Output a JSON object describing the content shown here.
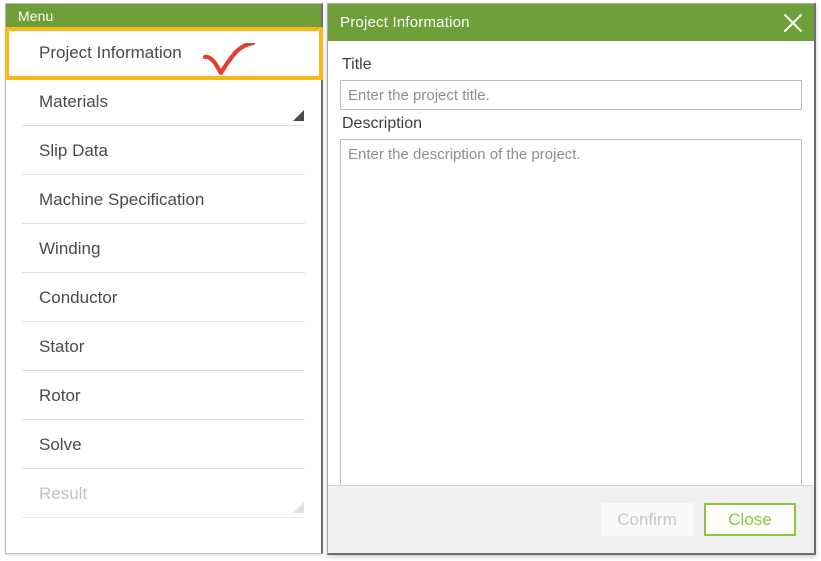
{
  "colors": {
    "header_green": "#6f9f38",
    "highlight_orange": "#f6b91c",
    "check_red": "#e0402c",
    "close_green": "#8cc63f",
    "disabled_grey": "#c2c2c2"
  },
  "menu_panel": {
    "header_title": "Menu",
    "items": [
      {
        "label": "Project Information",
        "selected": true,
        "disabled": false,
        "grip": false
      },
      {
        "label": "Materials",
        "selected": false,
        "disabled": false,
        "grip": true
      },
      {
        "label": "Slip Data",
        "selected": false,
        "disabled": false,
        "grip": false
      },
      {
        "label": "Machine Specification",
        "selected": false,
        "disabled": false,
        "grip": false
      },
      {
        "label": "Winding",
        "selected": false,
        "disabled": false,
        "grip": false
      },
      {
        "label": "Conductor",
        "selected": false,
        "disabled": false,
        "grip": false
      },
      {
        "label": "Stator",
        "selected": false,
        "disabled": false,
        "grip": false
      },
      {
        "label": "Rotor",
        "selected": false,
        "disabled": false,
        "grip": false
      },
      {
        "label": "Solve",
        "selected": false,
        "disabled": false,
        "grip": false
      },
      {
        "label": "Result",
        "selected": false,
        "disabled": true,
        "grip": true
      }
    ],
    "annotation": {
      "icon": "check-mark-icon"
    }
  },
  "dialog": {
    "title": "Project Information",
    "close_icon": "close-icon",
    "fields": {
      "title": {
        "label": "Title",
        "value": "",
        "placeholder": "Enter the project title."
      },
      "description": {
        "label": "Description",
        "value": "",
        "placeholder": "Enter the description of the project."
      }
    },
    "footer": {
      "confirm_label": "Confirm",
      "confirm_disabled": true,
      "close_label": "Close"
    }
  }
}
